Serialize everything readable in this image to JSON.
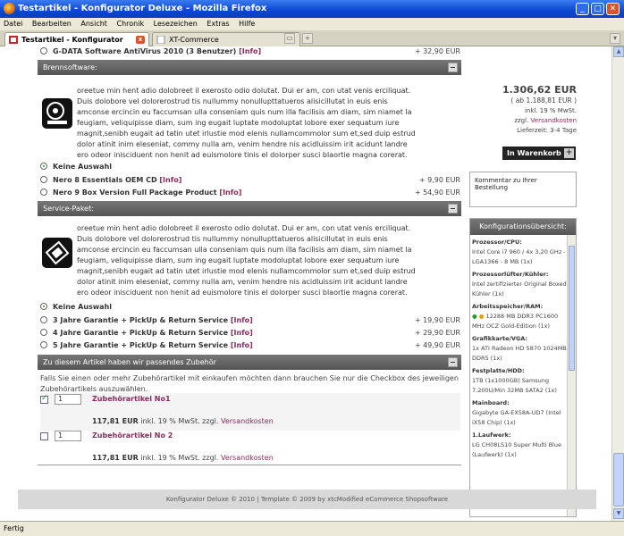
{
  "window": {
    "title": "Testartikel - Konfigurator Deluxe - Mozilla Firefox"
  },
  "menu": [
    "Datei",
    "Bearbeiten",
    "Ansicht",
    "Chronik",
    "Lesezeichen",
    "Extras",
    "Hilfe"
  ],
  "tabs": [
    {
      "label": "Testartikel - Konfigurator Deluxe",
      "active": true
    },
    {
      "label": "XT-Commerce",
      "active": false
    }
  ],
  "status": "Fertig",
  "top_item": {
    "label": "G-DATA Software AntiVirus 2010 (3 Benutzer)",
    "info": "[Info]",
    "price": "+ 32,90 EUR"
  },
  "sections": {
    "brennsoftware": {
      "title": "Brennsoftware:",
      "description": "oreetue min hent adio dolobreet il exerosto odio dolutat. Dui er am, con utat venis erciliquat. Duis dolobore vel dolorerostrud tis nullummy nonullupttatueros alisicillutat in euis enis amconse ercincin eu faccumsan ulla conseniam quis num illa facilisis am diam, sim niamet la feugiam, veliquipisse diam, sum ing eugait luptate modoluptat lobore exer sequatum iure magnit,senibh eugait ad tatin utet irlustie mod elenis nullamcommolor sum et,sed duip estrud dolor atinit inim eleseniat, commy nulla am, venim hendre nis acidluissim irit acidunt landre ero odeor inisciduent non henit ad euismolore tinis el dolorper susci blaortie magna corerat.",
      "options": [
        {
          "label": "Keine Auswahl",
          "info": "",
          "price": "",
          "selected": true
        },
        {
          "label": "Nero 8 Essentials OEM CD",
          "info": "[Info]",
          "price": "+ 9,90 EUR",
          "selected": false
        },
        {
          "label": "Nero 9 Box Version Full Package Product",
          "info": "[Info]",
          "price": "+ 54,90 EUR",
          "selected": false
        }
      ]
    },
    "service": {
      "title": "Service-Paket:",
      "description": "oreetue min hent adio dolobreet il exerosto odio dolutat. Dui er am, con utat venis erciliquat. Duis dolobore vel dolorerostrud tis nullummy nonullupttatueros alisicillutat in euis enis amconse ercincin eu faccumsan ulla conseniam quis num illa facilisis am diam, sim niamet la feugiam, veliquipisse diam, sum ing eugait luptate modoluptat lobore exer sequatum iure magnit,senibh eugait ad tatin utet irlustie mod elenis nullamcommolor sum et,sed duip estrud dolor atinit inim eleseniat, commy nulla am, venim hendre nis acidluissim irit acidunt landre ero odeor inisciduent non henit ad euismolore tinis el dolorper susci blaortie magna corerat.",
      "options": [
        {
          "label": "Keine Auswahl",
          "info": "",
          "price": "",
          "selected": true
        },
        {
          "label": "3 Jahre Garantie + PickUp & Return Service",
          "info": "[Info]",
          "price": "+ 19,90 EUR",
          "selected": false
        },
        {
          "label": "4 Jahre Garantie + PickUp & Return Service",
          "info": "[Info]",
          "price": "+ 29,90 EUR",
          "selected": false
        },
        {
          "label": "5 Jahre Garantie + PickUp & Return Service",
          "info": "[Info]",
          "price": "+ 49,90 EUR",
          "selected": false
        }
      ]
    },
    "zubehoer": {
      "title": "Zu diesem Artikel haben wir passendes Zubehör",
      "intro": "Falls Sie einen oder mehr Zubehörartikel mit einkaufen möchten dann brauchen Sie nur die Checkbox des jeweiligen Zubehörartikels auszuwählen.",
      "items": [
        {
          "name": "Zubehörartikel No1",
          "qty": "1",
          "checked": true,
          "price": "117,81 EUR",
          "tax": "inkl. 19 % MwSt. zzgl.",
          "shipping": "Versandkosten"
        },
        {
          "name": "Zubehörartikel No 2",
          "qty": "1",
          "checked": false,
          "price": "117,81 EUR",
          "tax": "inkl. 19 % MwSt. zzgl.",
          "shipping": "Versandkosten"
        }
      ]
    }
  },
  "sidebar": {
    "price": "1.306,62 EUR",
    "net": "( ab 1.188,81 EUR )",
    "tax": "inkl. 19 % MwSt.",
    "shipping_prefix": "zzgl.",
    "shipping_link": "Versandkosten",
    "delivery": "Lieferzeit: 3-4 Tage",
    "cart_button": "In Warenkorb",
    "comment_label": "Kommentar zu Ihrer Bestellung",
    "config_title": "Konfigurationsübersicht:",
    "config": [
      {
        "h": "Prozessor/CPU:",
        "v": "Intel Core i7 960 / 4x 3,20 GHz - LGA1366 - 8 MB (1x)"
      },
      {
        "h": "Prozessorlüfter/Kühler:",
        "v": "Intel zertifizierter Original Boxed Kühler (1x)"
      },
      {
        "h": "Arbeitsspeicher/RAM:",
        "v": "12288 MB DDR3 PC1600 MHz OCZ Gold-Edition (1x)"
      },
      {
        "h": "Grafikkarte/VGA:",
        "v": "1x ATI Radeon HD 5870 1024MB DDR5 (1x)"
      },
      {
        "h": "Festplatte/HDD:",
        "v": "1TB (1x1000GB) Samsung 7.200U/Min 32MB SATA2 (1x)"
      },
      {
        "h": "Mainboard:",
        "v": "Gigabyte GA-EX58A-UD7 (Intel iX58 Chip) (1x)"
      },
      {
        "h": "1.Laufwerk:",
        "v": "LG CH08LS10 Super Multi Blue (Laufwerk) (1x)"
      }
    ]
  },
  "footer": "Konfigurator Deluxe © 2010 | Template © 2009 by xtcModified eCommerce Shopsoftware"
}
